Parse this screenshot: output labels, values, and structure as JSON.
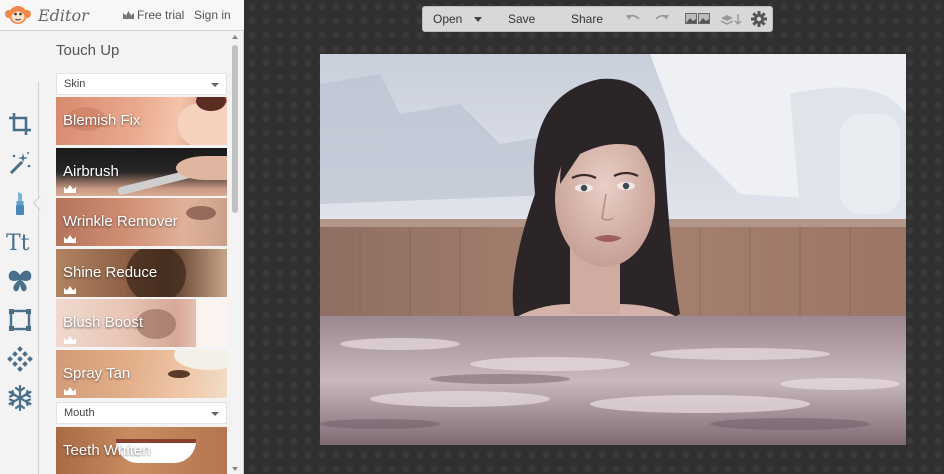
{
  "header": {
    "app_title": "Editor",
    "free_trial_label": "Free trial",
    "sign_in_label": "Sign in"
  },
  "tools": [
    {
      "name": "crop-icon"
    },
    {
      "name": "magic-wand-icon"
    },
    {
      "name": "lipstick-icon"
    },
    {
      "name": "text-icon",
      "glyph": "Tt"
    },
    {
      "name": "butterfly-icon"
    },
    {
      "name": "frame-icon"
    },
    {
      "name": "texture-icon"
    },
    {
      "name": "snowflake-icon"
    }
  ],
  "panel": {
    "section_title": "Touch Up",
    "skin_dropdown": "Skin",
    "mouth_dropdown": "Mouth",
    "effects": [
      {
        "label": "Blemish Fix",
        "premium": false
      },
      {
        "label": "Airbrush",
        "premium": true
      },
      {
        "label": "Wrinkle Remover",
        "premium": true
      },
      {
        "label": "Shine Reduce",
        "premium": true
      },
      {
        "label": "Blush Boost",
        "premium": true
      },
      {
        "label": "Spray Tan",
        "premium": true
      }
    ],
    "mouth_effects": [
      {
        "label": "Teeth Whiten",
        "premium": false
      }
    ]
  },
  "toolbar": {
    "open_label": "Open",
    "save_label": "Save",
    "share_label": "Share"
  },
  "colors": {
    "panel_bg": "#f3f3f3",
    "canvas_bg": "#303030",
    "toolbar_bg": "#d8d8d8",
    "accent_logo": "#f0874a"
  }
}
